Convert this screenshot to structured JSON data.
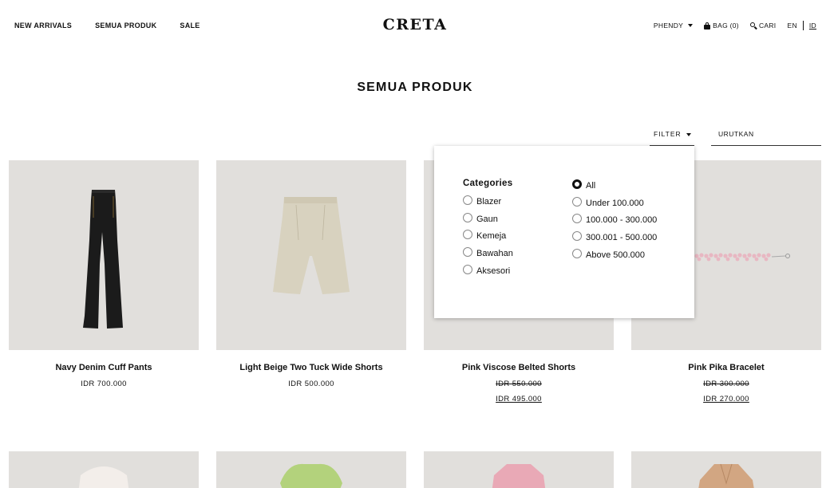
{
  "header": {
    "nav": [
      "NEW ARRIVALS",
      "SEMUA PRODUK",
      "SALE"
    ],
    "logo": "CRETA",
    "user": "PHENDY",
    "bag": "BAG (0)",
    "search": "CARI",
    "lang_en": "EN",
    "lang_id": "ID"
  },
  "page_title": "SEMUA PRODUK",
  "toolbar": {
    "filter_label": "FILTER",
    "sort_label": "URUTKAN"
  },
  "filter": {
    "categories_title": "Categories",
    "categories": [
      "Blazer",
      "Gaun",
      "Kemeja",
      "Bawahan",
      "Aksesori"
    ],
    "prices": [
      "All",
      "Under 100.000",
      "100.000 - 300.000",
      "300.001 - 500.000",
      "Above 500.000"
    ],
    "selected_price": "All"
  },
  "products": [
    {
      "name": "Navy Denim Cuff Pants",
      "price": "IDR 700.000"
    },
    {
      "name": "Light Beige Two Tuck Wide Shorts",
      "price": "IDR 500.000"
    },
    {
      "name": "Pink Viscose Belted Shorts",
      "old_price": "IDR 550.000",
      "new_price": "IDR 495.000"
    },
    {
      "name": "Pink Pika Bracelet",
      "old_price": "IDR 300.000",
      "new_price": "IDR 270.000"
    }
  ],
  "colors": {
    "image_bg": "#e1dfdc",
    "text": "#111111"
  }
}
